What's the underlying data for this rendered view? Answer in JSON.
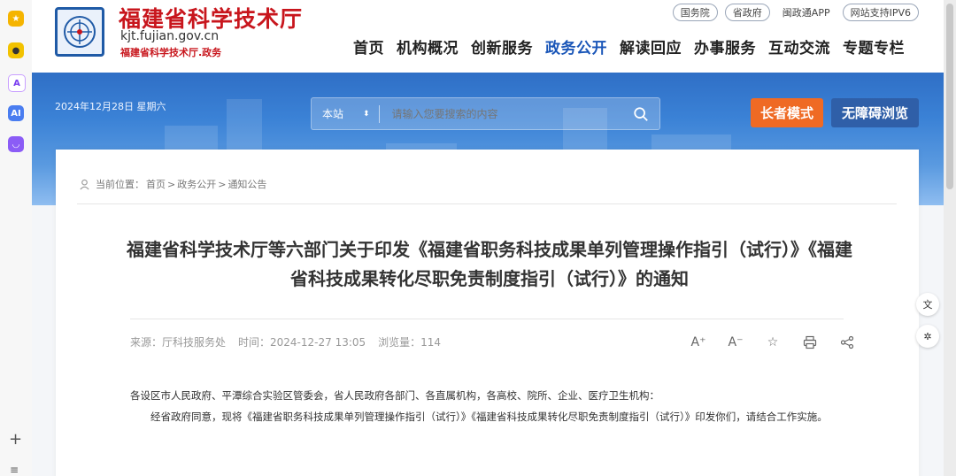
{
  "site": {
    "name": "福建省科学技术厅",
    "url": "kjt.fujian.gov.cn",
    "subtitle": "福建省科学技术厅.政务"
  },
  "top_links": {
    "state_council": "国务院",
    "provincial_gov": "省政府",
    "app": "闽政通APP",
    "ipv6": "网站支持IPV6"
  },
  "nav": [
    "首页",
    "机构概况",
    "创新服务",
    "政务公开",
    "解读回应",
    "办事服务",
    "互动交流",
    "专题专栏"
  ],
  "banner": {
    "date": "2024年12月28日  星期六",
    "search_scope": "本站",
    "search_placeholder": "请输入您要搜索的内容",
    "elder_mode": "长者模式",
    "accessibility": "无障碍浏览"
  },
  "breadcrumb": {
    "label": "当前位置：",
    "items": [
      "首页",
      "政务公开",
      "通知公告"
    ],
    "sep": ">"
  },
  "article": {
    "title": "福建省科学技术厅等六部门关于印发《福建省职务科技成果单列管理操作指引（试行）》《福建省科技成果转化尽职免责制度指引（试行）》的通知",
    "source": "来源：厅科技服务处",
    "time": "时间：2024-12-27 13:05",
    "views": "浏览量：114",
    "para1": "各设区市人民政府、平潭综合实验区管委会，省人民政府各部门、各直属机构，各高校、院所、企业、医疗卫生机构：",
    "para2": "经省政府同意，现将《福建省职务科技成果单列管理操作指引（试行）》《福建省科技成果转化尽职免责制度指引（试行）》印发你们，请结合工作实施。"
  },
  "tools": {
    "font_up": "A⁺",
    "font_down": "A⁻"
  },
  "colors": {
    "brand_red": "#c8161d",
    "nav_active": "#1a56b8",
    "elder_btn": "#ef6a24",
    "access_btn": "#2f5fa8"
  }
}
